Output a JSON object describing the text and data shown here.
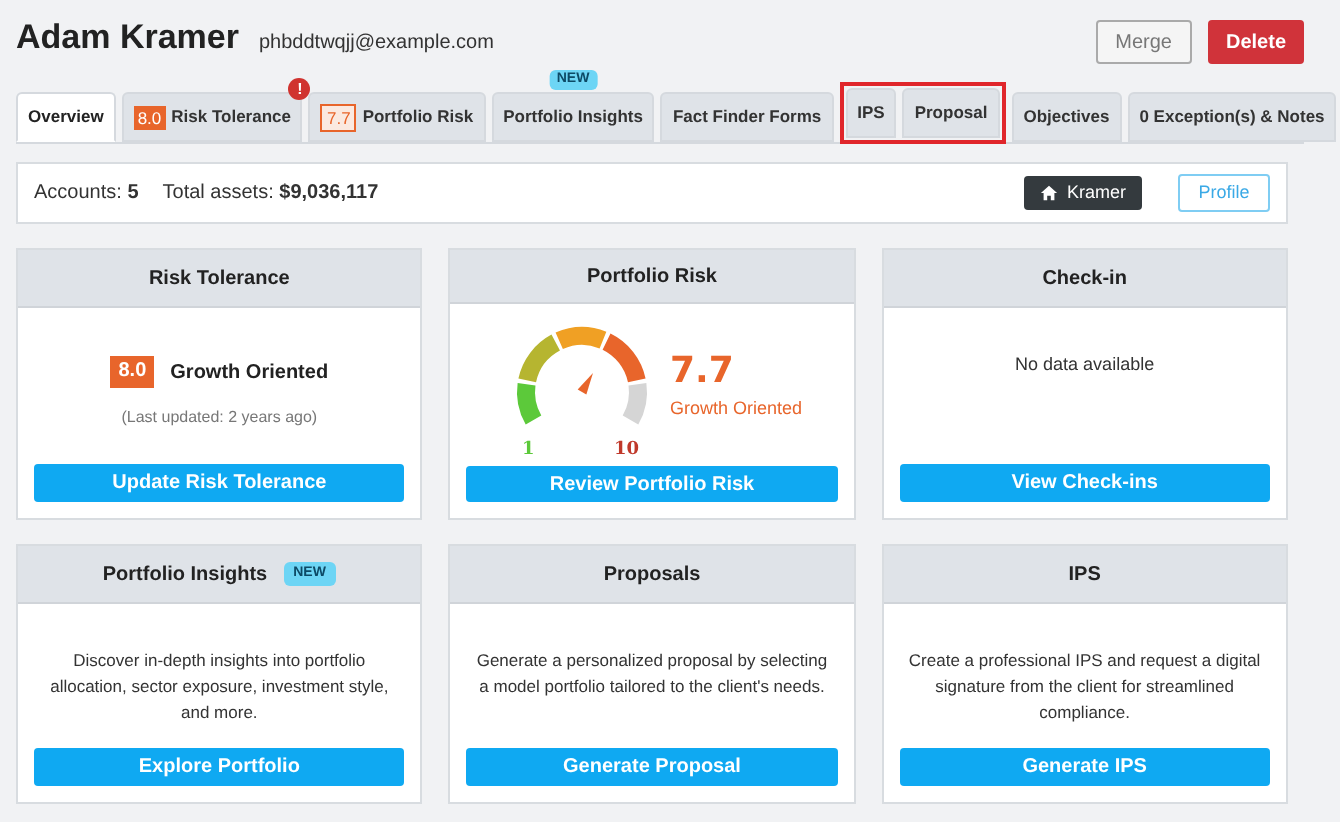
{
  "client": {
    "name": "Adam Kramer",
    "email": "phbddtwqjj@example.com"
  },
  "header_buttons": [
    {
      "label": "Merge",
      "kind": "outline"
    },
    {
      "label": "Delete",
      "kind": "danger"
    }
  ],
  "tabs": [
    {
      "kind": "tab",
      "label": "Overview",
      "selected": true
    },
    {
      "kind": "tab",
      "label": "Risk Tolerance",
      "selected": false,
      "score": "8.0",
      "score_filled": true,
      "alert": "!"
    },
    {
      "kind": "tab",
      "label": "Portfolio Risk",
      "selected": false,
      "score": "7.7",
      "score_filled": false
    },
    {
      "kind": "tab",
      "label": "Portfolio Insights",
      "selected": false,
      "badge": "NEW"
    },
    {
      "kind": "tab",
      "label": "Fact Finder Forms",
      "selected": false
    },
    {
      "kind": "highlight",
      "tabs": [
        {
          "label": "IPS",
          "selected": false
        },
        {
          "label": "Proposal",
          "selected": false
        }
      ]
    },
    {
      "kind": "tab",
      "label": "Objectives",
      "selected": false
    },
    {
      "kind": "tab",
      "label": "0 Exception(s) & Notes",
      "selected": false
    }
  ],
  "summary": {
    "accounts_label": "Accounts:",
    "accounts": "5",
    "assets_label": "Total assets:",
    "assets": "$9,036,117",
    "household_button": "Kramer",
    "profile_button": "Profile"
  },
  "cards": [
    {
      "kind": "risk",
      "title": "Risk Tolerance",
      "score": "8.0",
      "score_label": "Growth Oriented",
      "note": "(Last updated: 2 years ago)",
      "button": "Update Risk Tolerance"
    },
    {
      "kind": "gauge",
      "title": "Portfolio Risk",
      "min_label": "1",
      "max_label": "10",
      "value": "7.7",
      "value_label": "Growth Oriented",
      "button": "Review Portfolio Risk"
    },
    {
      "kind": "empty",
      "title": "Check-in",
      "message": "No data available",
      "button": "View Check-ins"
    },
    {
      "kind": "text",
      "title": "Portfolio Insights",
      "badge": "NEW",
      "text": "Discover in-depth insights into portfolio allocation, sector exposure, investment style, and more.",
      "button": "Explore Portfolio"
    },
    {
      "kind": "text",
      "title": "Proposals",
      "text": "Generate a personalized proposal by selecting a model portfolio tailored to the client's needs.",
      "button": "Generate Proposal"
    },
    {
      "kind": "text",
      "title": "IPS",
      "text": "Create a professional IPS and request a digital signature from the client for streamlined compliance.",
      "button": "Generate IPS"
    }
  ]
}
